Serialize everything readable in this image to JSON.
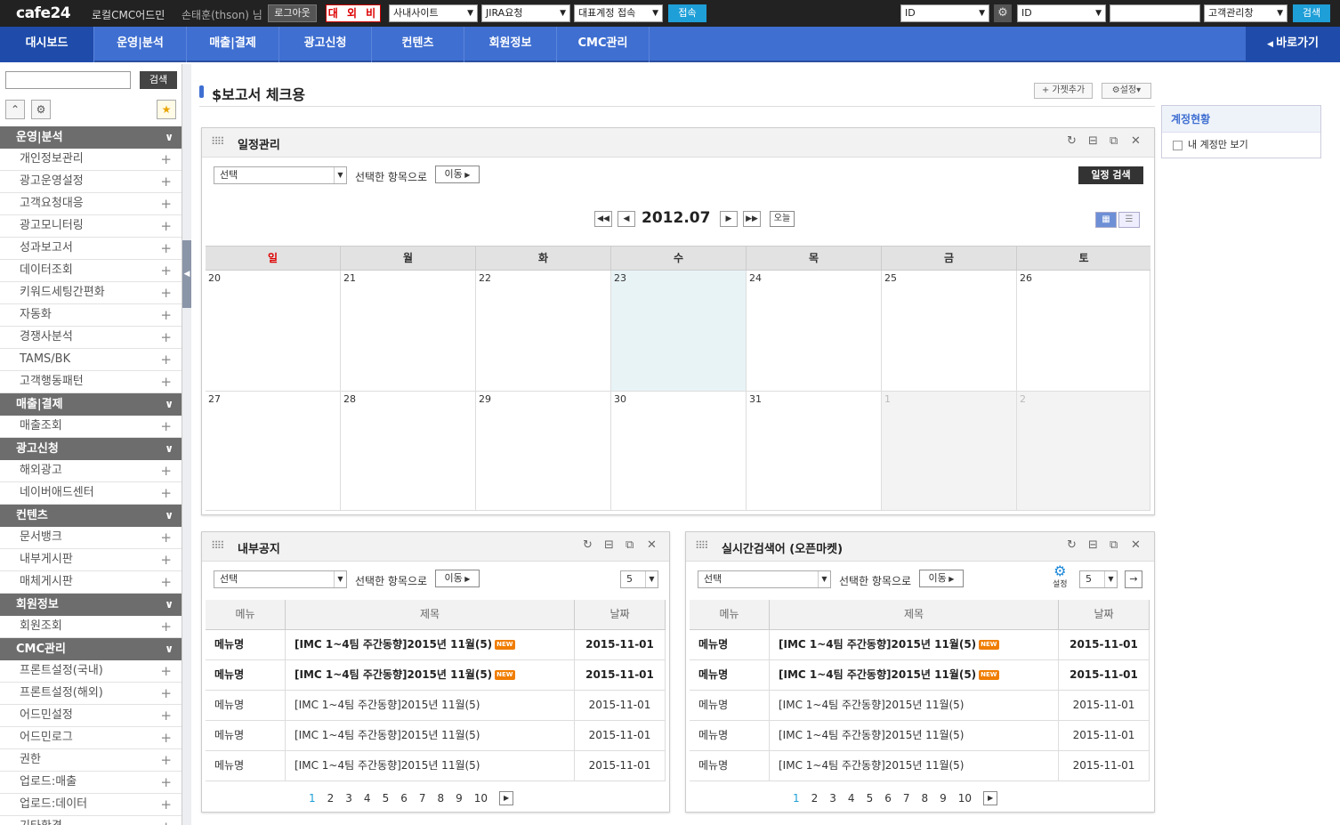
{
  "topbar": {
    "logo": "cafe24",
    "app_name": "로컬CMC어드민",
    "user": "손태훈(thson) 님",
    "logout": "로그아웃",
    "badge": "대 외 비",
    "site_select": "사내사이트",
    "jira_select": "JIRA요청",
    "account_select": "대표계정 접속",
    "connect": "접속",
    "id_select1": "ID",
    "id_select2": "ID",
    "customer_select": "고객관리창",
    "search": "검색"
  },
  "nav": {
    "items": [
      "대시보드",
      "운영|분석",
      "매출|결제",
      "광고신청",
      "컨텐츠",
      "회원정보",
      "CMC관리"
    ],
    "back": "바로가기"
  },
  "sidebar": {
    "search_btn": "검색",
    "menu": [
      {
        "type": "cat",
        "label": "운영|분석"
      },
      {
        "type": "item",
        "label": "개인정보관리"
      },
      {
        "type": "item",
        "label": "광고운영설정"
      },
      {
        "type": "item",
        "label": "고객요청대응"
      },
      {
        "type": "item",
        "label": "광고모니터링"
      },
      {
        "type": "item",
        "label": "성과보고서"
      },
      {
        "type": "item",
        "label": "데이터조회"
      },
      {
        "type": "item",
        "label": "키워드세팅간편화"
      },
      {
        "type": "item",
        "label": "자동화"
      },
      {
        "type": "item",
        "label": "경쟁사분석"
      },
      {
        "type": "item",
        "label": "TAMS/BK"
      },
      {
        "type": "item",
        "label": "고객행동패턴"
      },
      {
        "type": "cat",
        "label": "매출|결제"
      },
      {
        "type": "item",
        "label": "매출조회"
      },
      {
        "type": "cat",
        "label": "광고신청"
      },
      {
        "type": "item",
        "label": "해외광고"
      },
      {
        "type": "item",
        "label": "네이버애드센터"
      },
      {
        "type": "cat",
        "label": "컨텐츠"
      },
      {
        "type": "item",
        "label": "문서뱅크"
      },
      {
        "type": "item",
        "label": "내부게시판"
      },
      {
        "type": "item",
        "label": "매체게시판"
      },
      {
        "type": "cat",
        "label": "회원정보"
      },
      {
        "type": "item",
        "label": "회원조회"
      },
      {
        "type": "cat",
        "label": "CMC관리"
      },
      {
        "type": "item",
        "label": "프론트설정(국내)"
      },
      {
        "type": "item",
        "label": "프론트설정(해외)"
      },
      {
        "type": "item",
        "label": "어드민설정"
      },
      {
        "type": "item",
        "label": "어드민로그"
      },
      {
        "type": "item",
        "label": "권한"
      },
      {
        "type": "item",
        "label": "업로드:매출"
      },
      {
        "type": "item",
        "label": "업로드:데이터"
      },
      {
        "type": "item",
        "label": "기타환경"
      }
    ]
  },
  "page": {
    "title": "$보고서 체크용",
    "add_gadget": "가젯추가",
    "settings": "설정"
  },
  "account_status": {
    "title": "계정현황",
    "checkbox_label": "내 계정만 보기"
  },
  "schedule": {
    "title": "일정관리",
    "select": "선택",
    "selected_items": "선택한 항목으로",
    "move": "이동",
    "search": "일정 검색",
    "month": "2012.07",
    "today": "오늘",
    "weekdays": [
      "일",
      "월",
      "화",
      "수",
      "목",
      "금",
      "토"
    ],
    "days": [
      "20",
      "21",
      "22",
      "23",
      "24",
      "25",
      "26",
      "27",
      "28",
      "29",
      "30",
      "31",
      "1",
      "2"
    ]
  },
  "notice": {
    "title": "내부공지",
    "select": "선택",
    "selected_items": "선택한 항목으로",
    "move": "이동",
    "page_size": "5",
    "columns": [
      "메뉴",
      "제목",
      "날짜"
    ],
    "rows": [
      {
        "menu": "메뉴명",
        "title": "[IMC 1~4팀 주간동향]2015년 11월(5)",
        "date": "2015-11-01",
        "bold": true,
        "new": "NEW"
      },
      {
        "menu": "메뉴명",
        "title": "[IMC 1~4팀 주간동향]2015년 11월(5)",
        "date": "2015-11-01",
        "bold": true,
        "new": "NEW"
      },
      {
        "menu": "메뉴명",
        "title": "[IMC 1~4팀 주간동향]2015년 11월(5)",
        "date": "2015-11-01",
        "bold": false,
        "new": ""
      },
      {
        "menu": "메뉴명",
        "title": "[IMC 1~4팀 주간동향]2015년 11월(5)",
        "date": "2015-11-01",
        "bold": false,
        "new": ""
      },
      {
        "menu": "메뉴명",
        "title": "[IMC 1~4팀 주간동향]2015년 11월(5)",
        "date": "2015-11-01",
        "bold": false,
        "new": ""
      }
    ],
    "pages": [
      "1",
      "2",
      "3",
      "4",
      "5",
      "6",
      "7",
      "8",
      "9",
      "10"
    ]
  },
  "realtime": {
    "title": "실시간검색어 (오픈마켓)",
    "select": "선택",
    "selected_items": "선택한 항목으로",
    "move": "이동",
    "settings": "설정",
    "page_size": "5",
    "columns": [
      "메뉴",
      "제목",
      "날짜"
    ],
    "rows": [
      {
        "menu": "메뉴명",
        "title": "[IMC 1~4팀 주간동향]2015년 11월(5)",
        "date": "2015-11-01",
        "bold": true,
        "new": "NEW"
      },
      {
        "menu": "메뉴명",
        "title": "[IMC 1~4팀 주간동향]2015년 11월(5)",
        "date": "2015-11-01",
        "bold": true,
        "new": "NEW"
      },
      {
        "menu": "메뉴명",
        "title": "[IMC 1~4팀 주간동향]2015년 11월(5)",
        "date": "2015-11-01",
        "bold": false,
        "new": ""
      },
      {
        "menu": "메뉴명",
        "title": "[IMC 1~4팀 주간동향]2015년 11월(5)",
        "date": "2015-11-01",
        "bold": false,
        "new": ""
      },
      {
        "menu": "메뉴명",
        "title": "[IMC 1~4팀 주간동향]2015년 11월(5)",
        "date": "2015-11-01",
        "bold": false,
        "new": ""
      }
    ],
    "pages": [
      "1",
      "2",
      "3",
      "4",
      "5",
      "6",
      "7",
      "8",
      "9",
      "10"
    ]
  },
  "colors": {
    "nav": "#3f6fd1",
    "nav_active": "#1f4cab",
    "sidebar_cat": "#6d6d6d",
    "today": "#e8f3f6",
    "new_badge": "#f07d00",
    "sunday": "#dd0000"
  }
}
